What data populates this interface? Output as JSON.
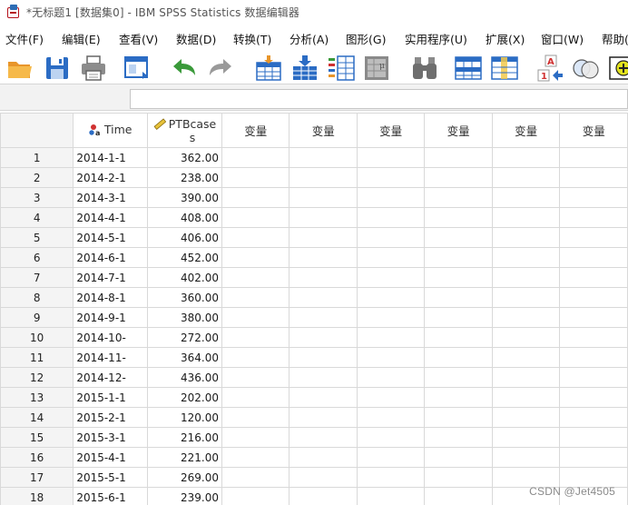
{
  "window": {
    "title": "*无标题1 [数据集0] - IBM SPSS Statistics 数据编辑器"
  },
  "menu": {
    "items": [
      "文件(F)",
      "编辑(E)",
      "查看(V)",
      "数据(D)",
      "转换(T)",
      "分析(A)",
      "图形(G)",
      "实用程序(U)",
      "扩展(X)",
      "窗口(W)",
      "帮助(H)"
    ]
  },
  "toolbar": {
    "buttons": [
      "open-icon",
      "save-icon",
      "print-icon",
      "dialog-recall-icon",
      "undo-icon",
      "redo-icon",
      "goto-case-icon",
      "goto-variable-icon",
      "variables-icon",
      "run-descriptives-icon",
      "find-icon",
      "insert-cases-icon",
      "insert-variable-icon",
      "split-file-icon",
      "weight-cases-icon",
      "select-cases-icon",
      "value-labels-icon"
    ]
  },
  "cell_editor": {
    "value": ""
  },
  "grid": {
    "columns": {
      "time": "Time",
      "ptbcases_line1": "PTBcase",
      "ptbcases_line2": "s",
      "empty": "变量"
    },
    "rows": [
      {
        "n": "1",
        "time": "2014-1-1",
        "ptb": "362.00"
      },
      {
        "n": "2",
        "time": "2014-2-1",
        "ptb": "238.00"
      },
      {
        "n": "3",
        "time": "2014-3-1",
        "ptb": "390.00"
      },
      {
        "n": "4",
        "time": "2014-4-1",
        "ptb": "408.00"
      },
      {
        "n": "5",
        "time": "2014-5-1",
        "ptb": "406.00"
      },
      {
        "n": "6",
        "time": "2014-6-1",
        "ptb": "452.00"
      },
      {
        "n": "7",
        "time": "2014-7-1",
        "ptb": "402.00"
      },
      {
        "n": "8",
        "time": "2014-8-1",
        "ptb": "360.00"
      },
      {
        "n": "9",
        "time": "2014-9-1",
        "ptb": "380.00"
      },
      {
        "n": "10",
        "time": "2014-10-",
        "ptb": "272.00"
      },
      {
        "n": "11",
        "time": "2014-11-",
        "ptb": "364.00"
      },
      {
        "n": "12",
        "time": "2014-12-",
        "ptb": "436.00"
      },
      {
        "n": "13",
        "time": "2015-1-1",
        "ptb": "202.00"
      },
      {
        "n": "14",
        "time": "2015-2-1",
        "ptb": "120.00"
      },
      {
        "n": "15",
        "time": "2015-3-1",
        "ptb": "216.00"
      },
      {
        "n": "16",
        "time": "2015-4-1",
        "ptb": "221.00"
      },
      {
        "n": "17",
        "time": "2015-5-1",
        "ptb": "269.00"
      },
      {
        "n": "18",
        "time": "2015-6-1",
        "ptb": "239.00"
      }
    ]
  },
  "watermark": "CSDN @Jet4505",
  "colors": {
    "toolbar_blue": "#2b6cc4",
    "open_orange": "#f2a93b",
    "undo_green": "#3a9a3a",
    "grid_line": "#d9d9d9"
  }
}
